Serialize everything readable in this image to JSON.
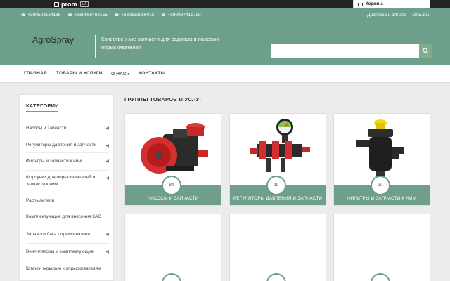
{
  "topbar": {
    "logo_text": "prom",
    "logo_badge": "UA",
    "cart_label": "Корзина"
  },
  "header": {
    "phones": [
      "+380503154136",
      "+380666466155",
      "+380633066012",
      "+380987419739"
    ],
    "links": [
      "Доставка и оплата",
      "Отзывы"
    ],
    "brand": "AgroSpray",
    "tagline": "Качественные запчасти для садовых и полевых опрыскивателей",
    "search_placeholder": ""
  },
  "nav": {
    "items": [
      "ГЛАВНАЯ",
      "ТОВАРЫ И УСЛУГИ",
      "О НАС ▸",
      "КОНТАКТЫ"
    ]
  },
  "sidebar": {
    "title": "КАТЕГОРИИ",
    "items": [
      "Насосы и запчасти",
      "Регуляторы давления и запчасти",
      "Фильтры и запчасти к ним",
      "Форсунки для опрыскивателей и запчасти к ним",
      "Распылители",
      "Комплектующие для внесения КАС",
      "Запчасти бака опрыскивателя",
      "Вентиляторы и комплектующие",
      "Штанги (крылья) к опрыскивателям"
    ]
  },
  "main": {
    "title": "ГРУППЫ ТОВАРОВ И УСЛУГ",
    "cards": [
      {
        "count": "84",
        "label": "НАСОСЫ И ЗАПЧАСТИ"
      },
      {
        "count": "19",
        "label": "РЕГУЛЯТОРЫ ДАВЛЕНИЯ И ЗАПЧАСТИ"
      },
      {
        "count": "30",
        "label": "ФИЛЬТРЫ И ЗАПЧАСТИ К НИМ"
      }
    ]
  },
  "colors": {
    "accent": "#6d9f8a",
    "topbar": "#232323"
  }
}
